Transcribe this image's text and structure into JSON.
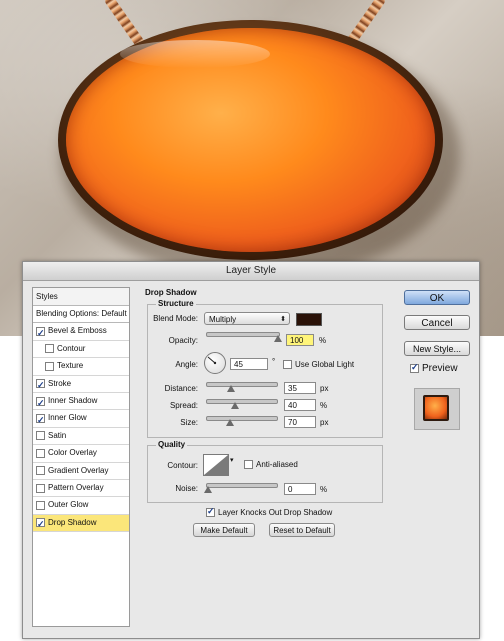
{
  "window": {
    "title": "Layer Style"
  },
  "styles_panel": {
    "header": "Styles",
    "blending_options": "Blending Options: Default",
    "items": [
      {
        "label": "Bevel & Emboss",
        "checked": true,
        "indent": false,
        "selected": false
      },
      {
        "label": "Contour",
        "checked": false,
        "indent": true,
        "selected": false
      },
      {
        "label": "Texture",
        "checked": false,
        "indent": true,
        "selected": false
      },
      {
        "label": "Stroke",
        "checked": true,
        "indent": false,
        "selected": false
      },
      {
        "label": "Inner Shadow",
        "checked": true,
        "indent": false,
        "selected": false
      },
      {
        "label": "Inner Glow",
        "checked": true,
        "indent": false,
        "selected": false
      },
      {
        "label": "Satin",
        "checked": false,
        "indent": false,
        "selected": false
      },
      {
        "label": "Color Overlay",
        "checked": false,
        "indent": false,
        "selected": false
      },
      {
        "label": "Gradient Overlay",
        "checked": false,
        "indent": false,
        "selected": false
      },
      {
        "label": "Pattern Overlay",
        "checked": false,
        "indent": false,
        "selected": false
      },
      {
        "label": "Outer Glow",
        "checked": false,
        "indent": false,
        "selected": false
      },
      {
        "label": "Drop Shadow",
        "checked": true,
        "indent": false,
        "selected": true
      }
    ]
  },
  "drop_shadow": {
    "title": "Drop Shadow",
    "structure": {
      "title": "Structure",
      "blend_mode_label": "Blend Mode:",
      "blend_mode_value": "Multiply",
      "shadow_color": "#2a1208",
      "opacity_label": "Opacity:",
      "opacity_value": "100",
      "opacity_unit": "%",
      "angle_label": "Angle:",
      "angle_value": "45",
      "angle_unit": "°",
      "use_global_light_label": "Use Global Light",
      "use_global_light_checked": false,
      "distance_label": "Distance:",
      "distance_value": "35",
      "distance_unit": "px",
      "spread_label": "Spread:",
      "spread_value": "40",
      "spread_unit": "%",
      "size_label": "Size:",
      "size_value": "70",
      "size_unit": "px"
    },
    "quality": {
      "title": "Quality",
      "contour_label": "Contour:",
      "anti_aliased_label": "Anti-aliased",
      "anti_aliased_checked": false,
      "noise_label": "Noise:",
      "noise_value": "0",
      "noise_unit": "%"
    },
    "knockout_label": "Layer Knocks Out Drop Shadow",
    "knockout_checked": true,
    "make_default": "Make Default",
    "reset_default": "Reset to Default"
  },
  "buttons": {
    "ok": "OK",
    "cancel": "Cancel",
    "new_style": "New Style...",
    "preview_label": "Preview",
    "preview_checked": true
  },
  "colors": {
    "selected_row": "#fbe67a",
    "highlight_field": "#fff57a",
    "ok_button": "#7fa8dd"
  }
}
